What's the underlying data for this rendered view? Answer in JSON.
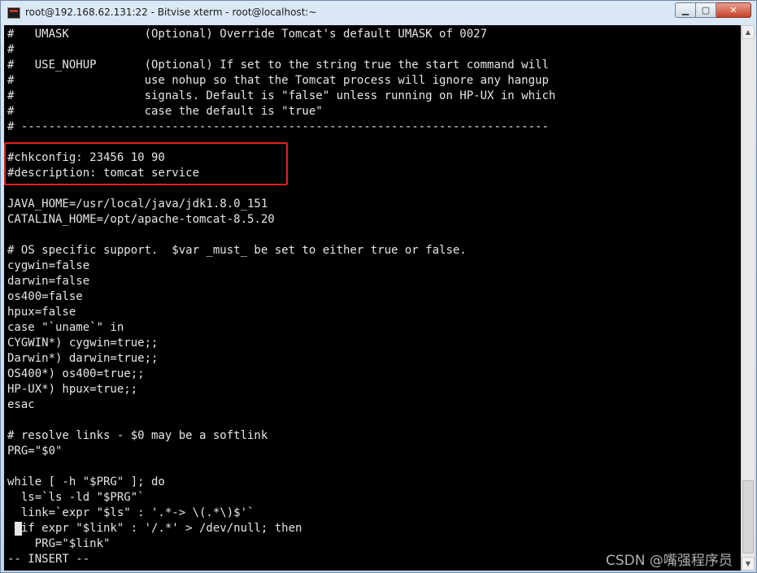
{
  "window": {
    "title": "root@192.168.62.131:22 - Bitvise xterm - root@localhost:~",
    "min_symbol": "▁",
    "max_symbol": "▢",
    "close_symbol": "✕"
  },
  "terminal": {
    "lines": [
      "#   UMASK           (Optional) Override Tomcat's default UMASK of 0027",
      "#",
      "#   USE_NOHUP       (Optional) If set to the string true the start command will",
      "#                   use nohup so that the Tomcat process will ignore any hangup",
      "#                   signals. Default is \"false\" unless running on HP-UX in which",
      "#                   case the default is \"true\"",
      "# -----------------------------------------------------------------------------",
      "",
      "#chkconfig: 23456 10 90",
      "#description: tomcat service",
      "",
      "JAVA_HOME=/usr/local/java/jdk1.8.0_151",
      "CATALINA_HOME=/opt/apache-tomcat-8.5.20",
      "",
      "# OS specific support.  $var _must_ be set to either true or false.",
      "cygwin=false",
      "darwin=false",
      "os400=false",
      "hpux=false",
      "case \"`uname`\" in",
      "CYGWIN*) cygwin=true;;",
      "Darwin*) darwin=true;;",
      "OS400*) os400=true;;",
      "HP-UX*) hpux=true;;",
      "esac",
      "",
      "# resolve links - $0 may be a softlink",
      "PRG=\"$0\"",
      "",
      "while [ -h \"$PRG\" ]; do",
      "  ls=`ls -ld \"$PRG\"`",
      "  link=`expr \"$ls\" : '.*-> \\(.*\\)$'`",
      "  if expr \"$link\" : '/.*' > /dev/null; then",
      "    PRG=\"$link\"",
      "-- INSERT --"
    ]
  },
  "watermark": "CSDN @嘴强程序员",
  "colors": {
    "terminal_bg": "#000000",
    "terminal_fg": "#e6e6e6",
    "highlight": "#e02020"
  }
}
